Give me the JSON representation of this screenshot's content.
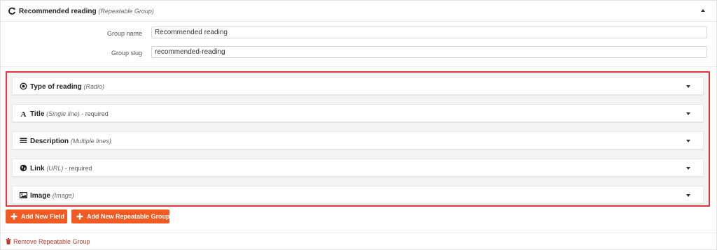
{
  "group": {
    "title": "Recommended reading",
    "type_label": "(Repeatable Group)",
    "collapse_icon": "caret-up-icon",
    "refresh_icon": "refresh-icon"
  },
  "settings": {
    "name_label": "Group name",
    "name_value": "Recommended reading",
    "slug_label": "Group slug",
    "slug_value": "recommended-reading"
  },
  "fields": [
    {
      "name": "Type of reading",
      "type": "(Radio)",
      "required": "",
      "icon": "radio-icon"
    },
    {
      "name": "Title",
      "type": "(Single line)",
      "required": " - required",
      "icon": "text-icon"
    },
    {
      "name": "Description",
      "type": "(Multiple lines)",
      "required": "",
      "icon": "lines-icon"
    },
    {
      "name": "Link",
      "type": "(URL)",
      "required": " - required",
      "icon": "globe-icon"
    },
    {
      "name": "Image",
      "type": "(Image)",
      "required": "",
      "icon": "image-icon"
    }
  ],
  "buttons": {
    "add_field": "Add New Field",
    "add_group": "Add New Repeatable Group"
  },
  "footer": {
    "remove_group": "Remove Repeatable Group"
  },
  "colors": {
    "accent": "#f15a22",
    "highlight_border": "#e0363f",
    "danger_link": "#c0392b"
  }
}
